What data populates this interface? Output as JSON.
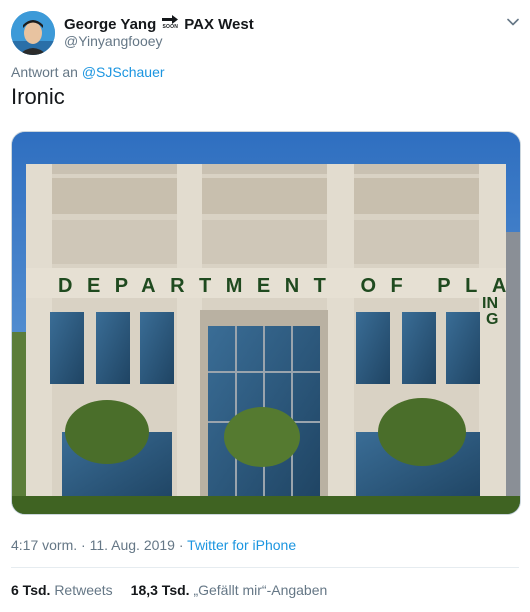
{
  "user": {
    "name_part1": "George Yang",
    "name_icon": "arrow-soon-icon",
    "name_icon_text": "SOON",
    "name_part2": "PAX West",
    "handle": "@Yinyangfooey"
  },
  "reply": {
    "prefix": "Antwort an",
    "mention": "@SJSchauer"
  },
  "text": "Ironic",
  "media": {
    "sign_main": "DEPARTMENT OF PLANN",
    "sign_extra1": "IN",
    "sign_extra2": "G"
  },
  "meta": {
    "time": "4:17 vorm.",
    "separator1": "·",
    "date": "11. Aug. 2019",
    "separator2": "·",
    "source": "Twitter for iPhone"
  },
  "stats": {
    "retweets_count": "6 Tsd.",
    "retweets_label": "Retweets",
    "likes_count": "18,3 Tsd.",
    "likes_label": "„Gefällt mir“-Angaben"
  },
  "colors": {
    "link": "#1b95e0",
    "secondary": "#657786",
    "primary": "#14171a",
    "sign_text": "#1f4a1f"
  }
}
